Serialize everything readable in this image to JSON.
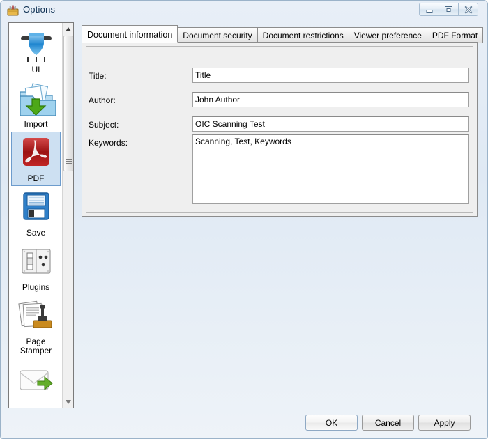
{
  "window": {
    "title": "Options",
    "app_icon": "toolbox-icon",
    "controls": [
      {
        "name": "minimize",
        "glyph": "minimize-icon"
      },
      {
        "name": "maximize",
        "glyph": "restore-icon"
      },
      {
        "name": "close",
        "glyph": "close-icon"
      }
    ]
  },
  "sidebar": {
    "items": [
      {
        "label": "UI",
        "icon": "ui-shield-icon",
        "selected": false
      },
      {
        "label": "Import",
        "icon": "import-folder-icon",
        "selected": false
      },
      {
        "label": "PDF",
        "icon": "pdf-icon",
        "selected": true
      },
      {
        "label": "Save",
        "icon": "floppy-disk-icon",
        "selected": false
      },
      {
        "label": "Plugins",
        "icon": "power-outlet-icon",
        "selected": false
      },
      {
        "label": "Page Stamper",
        "icon": "page-stamper-icon",
        "selected": false
      },
      {
        "label": "",
        "icon": "email-send-icon",
        "selected": false
      }
    ],
    "scrollbar": {
      "up_arrow": "scroll-up-icon",
      "down_arrow": "scroll-down-icon"
    }
  },
  "tabs": [
    {
      "label": "Document information",
      "active": true
    },
    {
      "label": "Document security",
      "active": false
    },
    {
      "label": "Document restrictions",
      "active": false
    },
    {
      "label": "Viewer preference",
      "active": false
    },
    {
      "label": "PDF Format",
      "active": false
    }
  ],
  "form": {
    "title": {
      "label": "Title:",
      "value": "Title",
      "placeholder": ""
    },
    "author": {
      "label": "Author:",
      "value": "John Author",
      "placeholder": ""
    },
    "subject": {
      "label": "Subject:",
      "value": "OIC Scanning Test",
      "placeholder": ""
    },
    "keywords": {
      "label": "Keywords:",
      "value": "Scanning, Test, Keywords",
      "placeholder": ""
    }
  },
  "footer": {
    "ok": "OK",
    "cancel": "Cancel",
    "apply": "Apply"
  },
  "colors": {
    "accent": "#6d9ccd",
    "selection_bg": "#cde0f2",
    "title_text": "#0d2f52",
    "panel_bg": "#efefef",
    "pdf_red": "#b31d1d",
    "green": "#5fae26"
  }
}
